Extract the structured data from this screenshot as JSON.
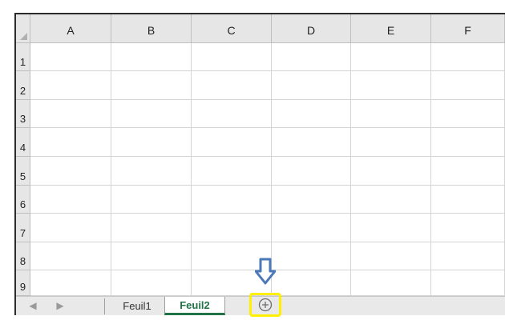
{
  "columns": [
    "A",
    "B",
    "C",
    "D",
    "E",
    "F"
  ],
  "rows": [
    "1",
    "2",
    "3",
    "4",
    "5",
    "6",
    "7",
    "8",
    "9"
  ],
  "sheet_tabs": [
    {
      "label": "Feuil1",
      "active": false
    },
    {
      "label": "Feuil2",
      "active": true
    }
  ],
  "nav": {
    "prev": "◀",
    "next": "▶"
  },
  "add_sheet": {
    "icon": "plus-circle-icon"
  },
  "annotation": {
    "arrow_icon": "down-arrow-icon",
    "highlight_color": "#ffef00",
    "arrow_color": "#4a78b8"
  },
  "colors": {
    "active_tab": "#217346",
    "header_bg": "#e6e6e6"
  }
}
